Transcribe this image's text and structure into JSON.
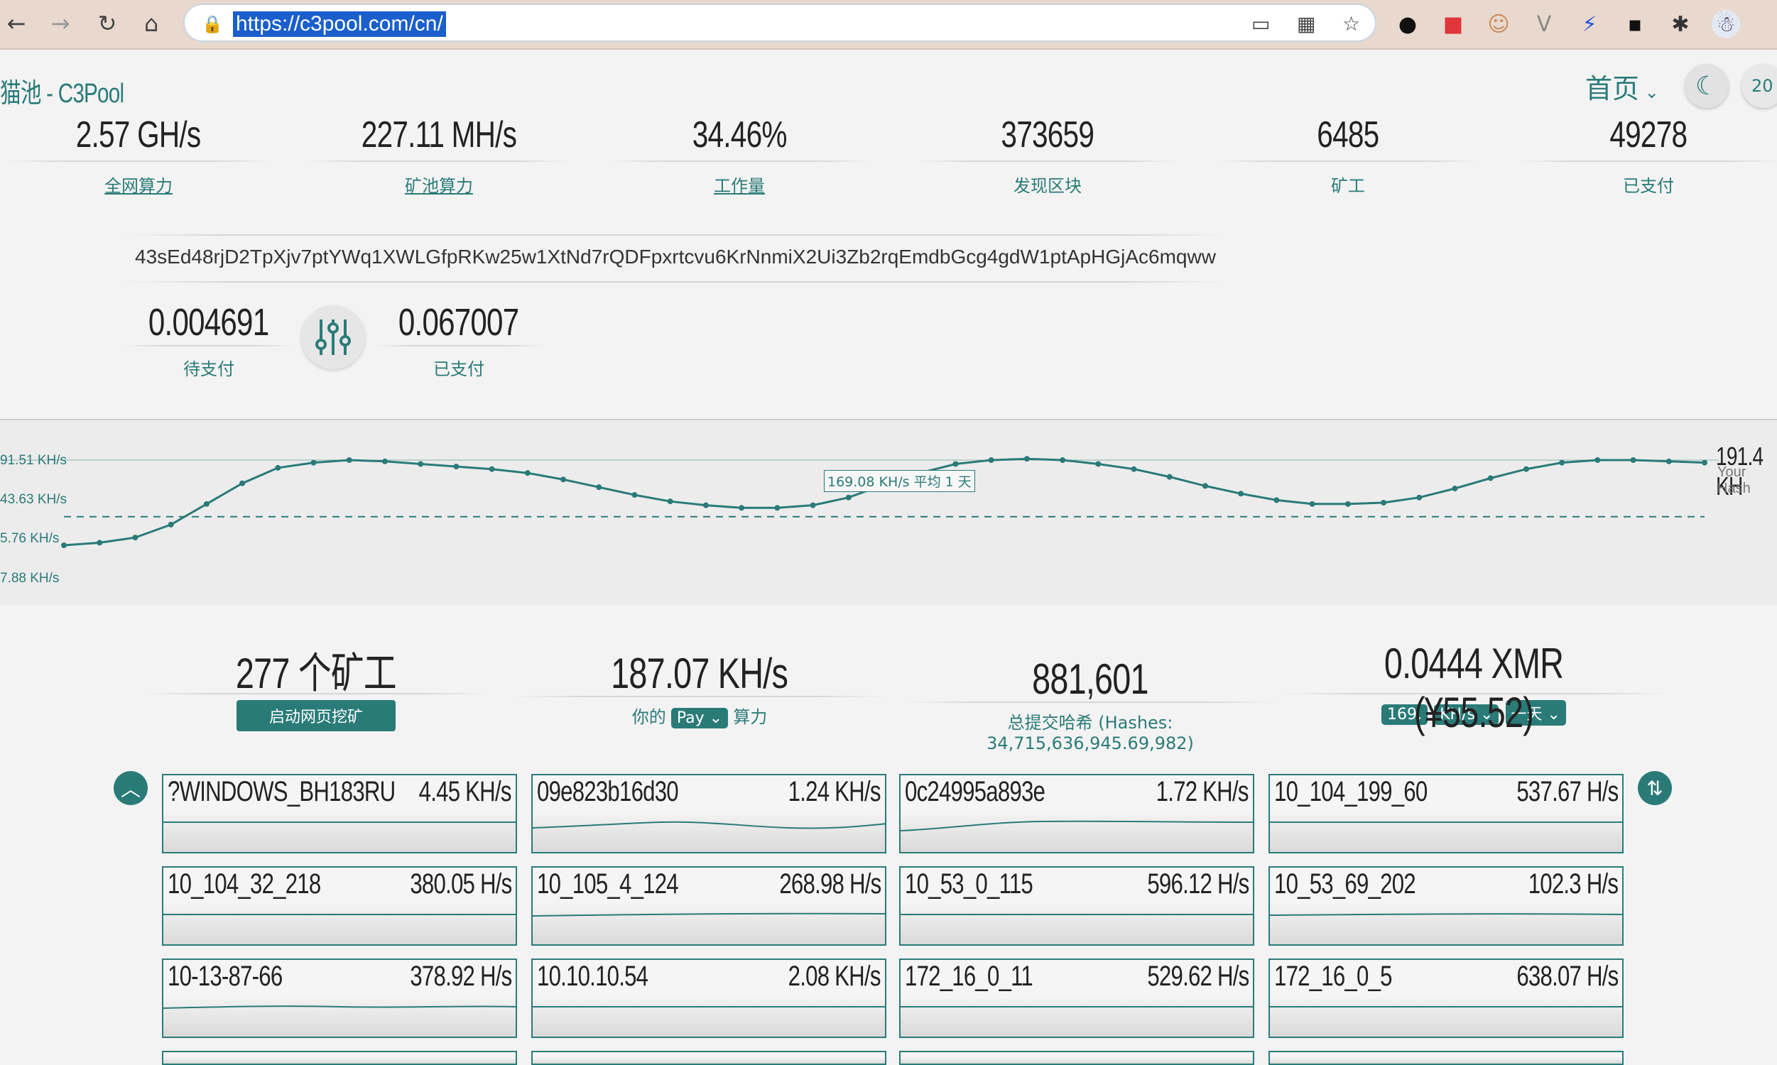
{
  "browser": {
    "url": "https://c3pool.com/cn/"
  },
  "header": {
    "site_title": "猫池 - C3Pool",
    "nav_home": "首页",
    "corner_text": "20"
  },
  "pool_stats": [
    {
      "value": "2.57 GH/s",
      "label": "全网算力",
      "link": true
    },
    {
      "value": "227.11 MH/s",
      "label": "矿池算力",
      "link": true
    },
    {
      "value": "34.46%",
      "label": "工作量",
      "link": true
    },
    {
      "value": "373659",
      "label": "发现区块",
      "link": false
    },
    {
      "value": "6485",
      "label": "矿工",
      "link": false
    },
    {
      "value": "49278",
      "label": "已支付",
      "link": false
    }
  ],
  "wallet": {
    "address": "43sEd48rjD2TpXjv7ptYWq1XWLGfpRKw25w1XtNd7rQDFpxrtcvu6KrNnmiX2Ui3Zb2rqEmdbGcg4gdW1ptApHGjAc6mqww",
    "pending_value": "0.004691",
    "pending_label": "待支付",
    "paid_value": "0.067007",
    "paid_label": "已支付"
  },
  "chart_data": {
    "type": "line",
    "y_tick_labels": [
      "91.51 KH/s",
      "43.63 KH/s",
      "5.76 KH/s",
      "7.88 KH/s"
    ],
    "average_label": "169.08 KH/s 平均 1 天",
    "average": 169.08,
    "current_value": "191.4 KH",
    "current_label": "Your Hash",
    "series": [
      {
        "values": [
          158,
          159,
          161,
          166,
          174,
          182,
          188,
          190,
          191,
          190.5,
          189.5,
          188.5,
          187.5,
          186,
          183.5,
          180.5,
          177.5,
          175,
          173.5,
          172.5,
          172.5,
          173.5,
          176.5,
          181.5,
          186,
          189.5,
          191,
          191.5,
          191,
          189.5,
          187.5,
          184.5,
          181,
          178,
          175.5,
          174,
          174,
          174.5,
          176.5,
          180,
          184,
          187.5,
          190,
          191,
          191,
          190.5,
          190
        ]
      }
    ]
  },
  "summary": {
    "workers_value": "277 个矿工",
    "start_mining": "启动网页挖矿",
    "hashrate_value": "187.07 KH/s",
    "hashrate_pre": "你的",
    "hashrate_select": "Pay",
    "hashrate_post": "算力",
    "hashes_value": "881,601",
    "hashes_label": "总提交哈希 (Hashes: 34,715,636,945.69,982)",
    "earnings_value": "0.0444 XMR (¥55.52)",
    "earn_input": "169.",
    "earn_unit": "KH/s",
    "earn_period": "一天"
  },
  "workers": [
    {
      "name": "?WINDOWS_BH183RU",
      "hashrate": "4.45 KH/s"
    },
    {
      "name": "09e823b16d30",
      "hashrate": "1.24 KH/s"
    },
    {
      "name": "0c24995a893e",
      "hashrate": "1.72 KH/s"
    },
    {
      "name": "10_104_199_60",
      "hashrate": "537.67 H/s"
    },
    {
      "name": "10_104_32_218",
      "hashrate": "380.05 H/s"
    },
    {
      "name": "10_105_4_124",
      "hashrate": "268.98 H/s"
    },
    {
      "name": "10_53_0_115",
      "hashrate": "596.12 H/s"
    },
    {
      "name": "10_53_69_202",
      "hashrate": "102.3 H/s"
    },
    {
      "name": "10-13-87-66",
      "hashrate": "378.92 H/s"
    },
    {
      "name": "10.10.10.54",
      "hashrate": "2.08 KH/s"
    },
    {
      "name": "172_16_0_11",
      "hashrate": "529.62 H/s"
    },
    {
      "name": "172_16_0_5",
      "hashrate": "638.07 H/s"
    }
  ],
  "colors": {
    "accent": "#2a7b78",
    "background": "#f3f3f3"
  }
}
